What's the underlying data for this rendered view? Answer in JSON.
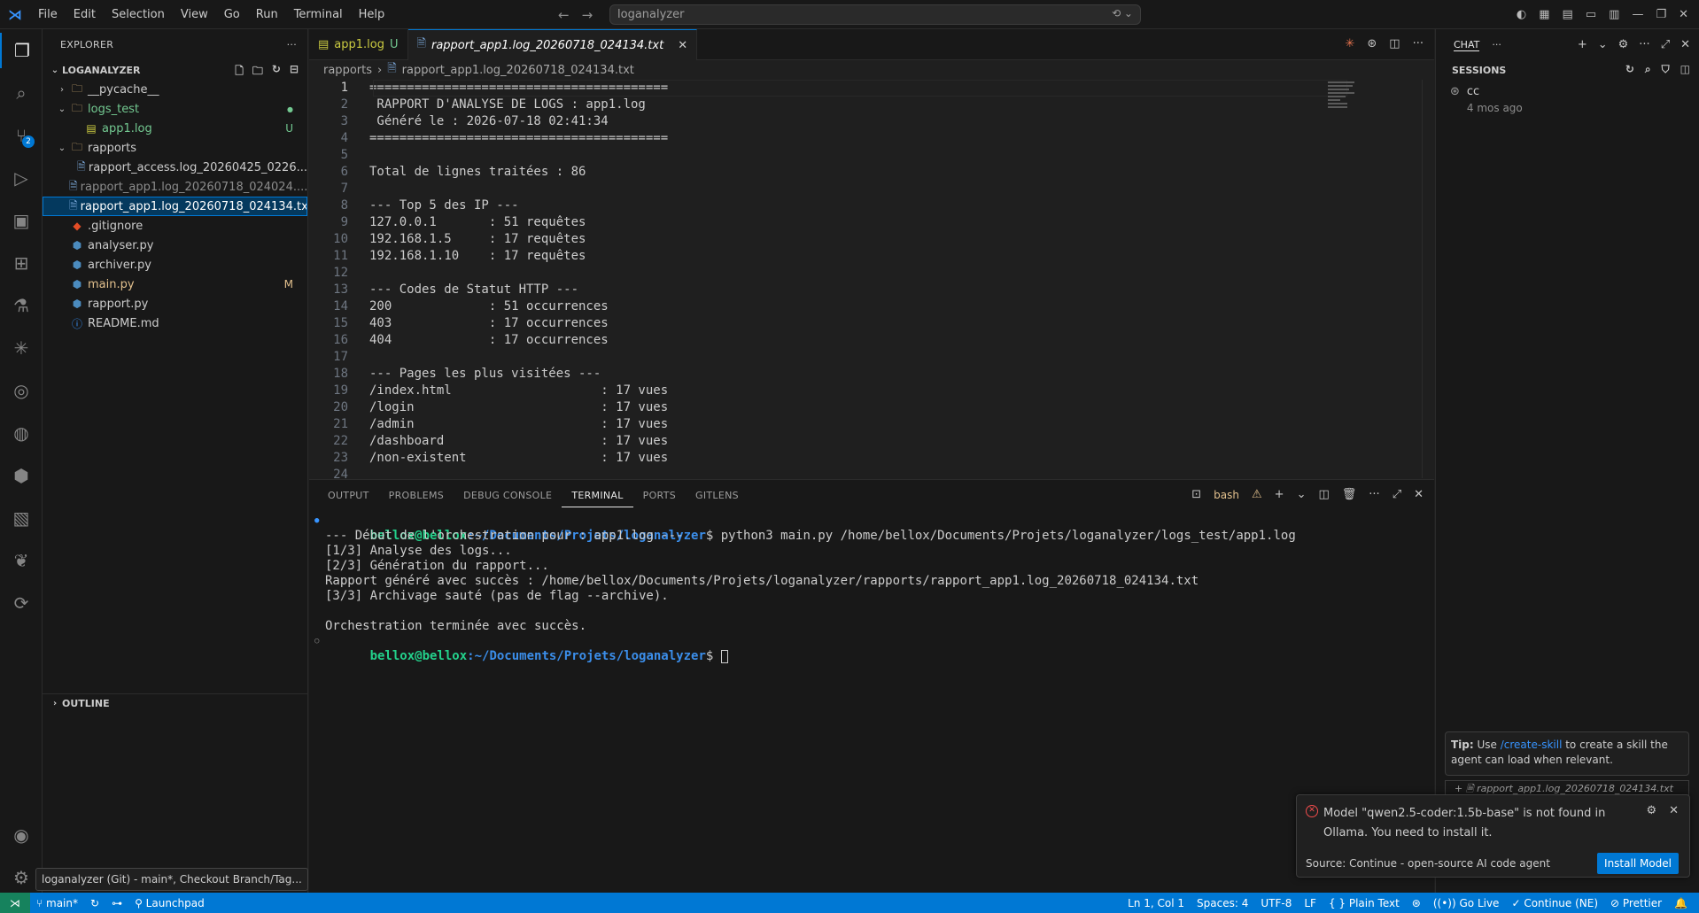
{
  "menu": [
    "File",
    "Edit",
    "Selection",
    "View",
    "Go",
    "Run",
    "Terminal",
    "Help"
  ],
  "command_center": {
    "text": "loganalyzer"
  },
  "sidebar": {
    "header": "EXPLORER",
    "root": "LOGANALYZER",
    "tree": [
      {
        "label": "__pycache__",
        "type": "folder",
        "indent": 1,
        "collapsed": true
      },
      {
        "label": "logs_test",
        "type": "folder",
        "indent": 1,
        "collapsed": false,
        "deco": "●"
      },
      {
        "label": "app1.log",
        "type": "log",
        "indent": 2,
        "deco": "U"
      },
      {
        "label": "rapports",
        "type": "folder",
        "indent": 1,
        "collapsed": false
      },
      {
        "label": "rapport_access.log_20260425_0226...",
        "type": "txt",
        "indent": 2
      },
      {
        "label": "rapport_app1.log_20260718_024024....",
        "type": "txt",
        "indent": 2,
        "dim": true
      },
      {
        "label": "rapport_app1.log_20260718_024134.txt",
        "type": "txt",
        "indent": 2,
        "selected": true
      },
      {
        "label": ".gitignore",
        "type": "git",
        "indent": 1
      },
      {
        "label": "analyser.py",
        "type": "py",
        "indent": 1
      },
      {
        "label": "archiver.py",
        "type": "py",
        "indent": 1
      },
      {
        "label": "main.py",
        "type": "py",
        "indent": 1,
        "deco": "M"
      },
      {
        "label": "rapport.py",
        "type": "py",
        "indent": 1
      },
      {
        "label": "README.md",
        "type": "info",
        "indent": 1
      }
    ],
    "outline": "OUTLINE",
    "tooltip": "loganalyzer (Git) - main*, Checkout Branch/Tag..."
  },
  "tabs": [
    {
      "label": "app1.log",
      "deco": "U",
      "active": false
    },
    {
      "label": "rapport_app1.log_20260718_024134.txt",
      "active": true
    }
  ],
  "breadcrumb": [
    "rapports",
    "rapport_app1.log_20260718_024134.txt"
  ],
  "code_lines": [
    "========================================",
    " RAPPORT D'ANALYSE DE LOGS : app1.log",
    " Généré le : 2026-07-18 02:41:34",
    "========================================",
    "",
    "Total de lignes traitées : 86",
    "",
    "--- Top 5 des IP ---",
    "127.0.0.1       : 51 requêtes",
    "192.168.1.5     : 17 requêtes",
    "192.168.1.10    : 17 requêtes",
    "",
    "--- Codes de Statut HTTP ---",
    "200             : 51 occurrences",
    "403             : 17 occurrences",
    "404             : 17 occurrences",
    "",
    "--- Pages les plus visitées ---",
    "/index.html                    : 17 vues",
    "/login                         : 17 vues",
    "/admin                         : 17 vues",
    "/dashboard                     : 17 vues",
    "/non-existent                  : 17 vues",
    ""
  ],
  "panel": {
    "tabs": [
      "OUTPUT",
      "PROBLEMS",
      "DEBUG CONSOLE",
      "TERMINAL",
      "PORTS",
      "GITLENS"
    ],
    "active_tab": "TERMINAL",
    "shell": "bash",
    "prompt_user": "bellox@bellox",
    "prompt_path": ":~/Documents/Projets/loganalyzer",
    "prompt_end": "$ ",
    "command": "python3 main.py /home/bellox/Documents/Projets/loganalyzer/logs_test/app1.log",
    "output": [
      "--- Début de l'orchestration pour : app1.log ---",
      "[1/3] Analyse des logs...",
      "[2/3] Génération du rapport...",
      "Rapport généré avec succès : /home/bellox/Documents/Projets/loganalyzer/rapports/rapport_app1.log_20260718_024134.txt",
      "[3/3] Archivage sauté (pas de flag --archive).",
      "",
      "Orchestration terminée avec succès."
    ]
  },
  "chat": {
    "title": "CHAT",
    "sessions_header": "SESSIONS",
    "session": {
      "title": "cc",
      "time": "4 mos ago"
    },
    "tip_bold": "Tip:",
    "tip_pre": " Use ",
    "tip_link": "/create-skill",
    "tip_post": " to create a skill the agent can load when relevant.",
    "chip": "rapport_app1.log_20260718_024134.txt"
  },
  "notification": {
    "message": "Model \"qwen2.5-coder:1.5b-base\" is not found in Ollama. You need to install it.",
    "source": "Source: Continue - open-source AI code agent",
    "button": "Install Model"
  },
  "statusbar": {
    "branch": "main*",
    "launchpad": "Launchpad",
    "position": "Ln 1, Col 1",
    "spaces": "Spaces: 4",
    "encoding": "UTF-8",
    "eol": "LF",
    "language": "Plain Text",
    "golive": "Go Live",
    "continue": "Continue (NE)",
    "prettier": "Prettier"
  },
  "colors": {
    "accent": "#0078d4",
    "statusbar": "#0078d4",
    "error": "#f14c4c",
    "term_user": "#23d18b",
    "term_path": "#3b8eea"
  }
}
